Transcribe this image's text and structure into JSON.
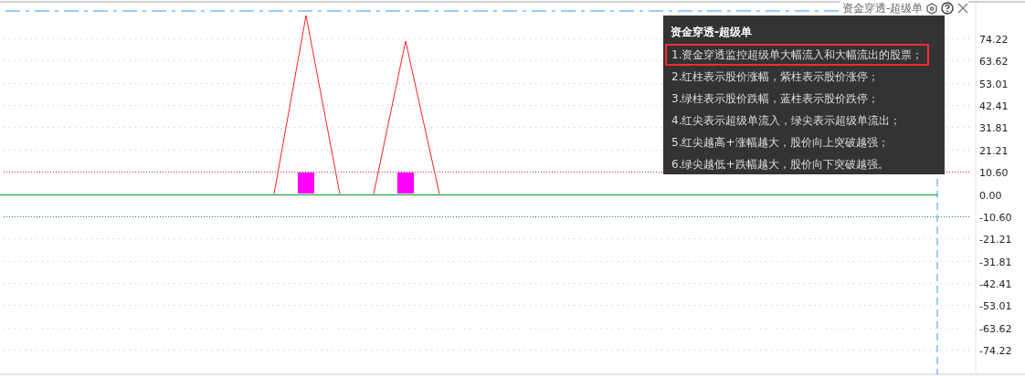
{
  "indicator": {
    "title": "资金穿透-超级单"
  },
  "tooltip": {
    "title": "资金穿透-超级单",
    "lines": [
      {
        "text": "1.资金穿透监控超级单大幅流入和大幅流出的股票；",
        "highlighted": true
      },
      {
        "text": "2.红柱表示股价涨幅，紫柱表示股价涨停；",
        "highlighted": false
      },
      {
        "text": "3.绿柱表示股价跌幅，蓝柱表示股价跌停；",
        "highlighted": false
      },
      {
        "text": "4.红尖表示超级单流入，绿尖表示超级单流出；",
        "highlighted": false
      },
      {
        "text": "5.红尖越高+涨幅越大，股价向上突破越强；",
        "highlighted": false
      },
      {
        "text": "6.绿尖越低+跌幅越大，股价向下突破越强。",
        "highlighted": false
      }
    ]
  },
  "y_axis": {
    "labels": [
      "74.22",
      "63.62",
      "53.01",
      "42.41",
      "31.81",
      "21.21",
      "10.60",
      "0.00",
      "-10.60",
      "-21.21",
      "-31.81",
      "-42.41",
      "-53.01",
      "-63.62",
      "-74.22"
    ]
  }
}
